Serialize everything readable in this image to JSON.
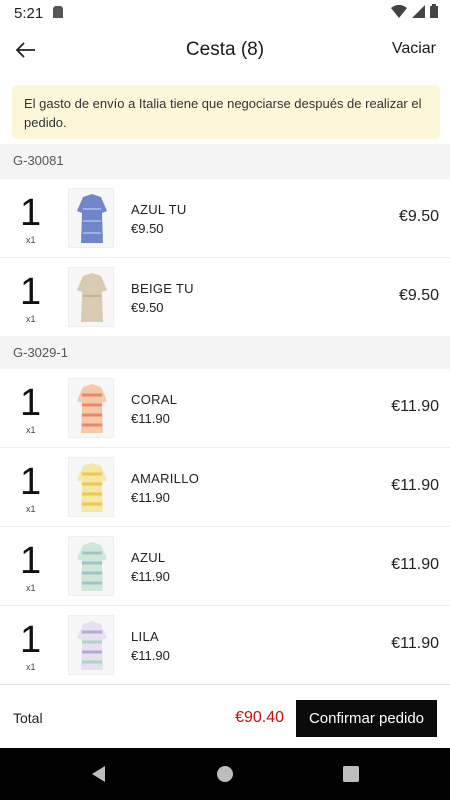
{
  "status": {
    "time": "5:21"
  },
  "header": {
    "title": "Cesta (8)",
    "clear_label": "Vaciar"
  },
  "notice": {
    "text": "El gasto de envío a Italia tiene que negociarse después de realizar el pedido."
  },
  "groups": [
    {
      "code": "G-30081",
      "items": [
        {
          "qty": "1",
          "qty_sub": "x1",
          "name": "AZUL  TU",
          "unit_price": "€9.50",
          "total": "€9.50",
          "colors": [
            "#6f86c9",
            "#9fb0de"
          ]
        },
        {
          "qty": "1",
          "qty_sub": "x1",
          "name": "BEIGE TU",
          "unit_price": "€9.50",
          "total": "€9.50",
          "colors": [
            "#d8cbb2",
            "#ebe1cd"
          ]
        }
      ]
    },
    {
      "code": "G-3029-1",
      "items": [
        {
          "qty": "1",
          "qty_sub": "x1",
          "name": "CORAL",
          "unit_price": "€11.90",
          "total": "€11.90",
          "colors": [
            "#e9866f",
            "#f4c9a8"
          ]
        },
        {
          "qty": "1",
          "qty_sub": "x1",
          "name": "AMARILLO",
          "unit_price": "€11.90",
          "total": "€11.90",
          "colors": [
            "#ecc94a",
            "#f5e7a8"
          ]
        },
        {
          "qty": "1",
          "qty_sub": "x1",
          "name": "AZUL",
          "unit_price": "€11.90",
          "total": "€11.90",
          "colors": [
            "#9fc5c8",
            "#cfe6d8"
          ]
        },
        {
          "qty": "1",
          "qty_sub": "x1",
          "name": "LILA",
          "unit_price": "€11.90",
          "total": "€11.90",
          "colors": [
            "#b7a8d4",
            "#a9d6c0"
          ]
        }
      ]
    }
  ],
  "footer": {
    "total_label": "Total",
    "total_amount": "€90.40",
    "confirm_label": "Confirmar pedido"
  },
  "colors": {
    "total_price": "#c80e0e",
    "notice_bg": "#fdf7da",
    "confirm_bg": "#0b0b0b"
  }
}
